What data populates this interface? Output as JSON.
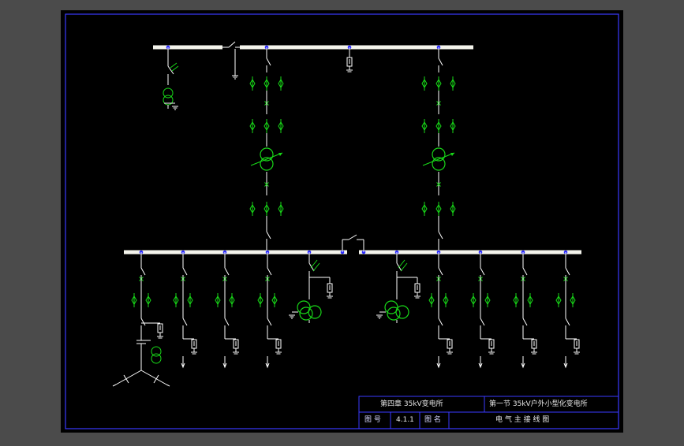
{
  "colors": {
    "background": "#4b4b4b",
    "sheet": "#000000",
    "frame": "#3a3aff",
    "busbar": "#f4f4ec",
    "equipment": "#18d818",
    "wiring": "#ffffff",
    "node": "#2a2aff"
  },
  "title_block": {
    "chapter": "第四章 35kV变电所",
    "section": "第一节 35kV户外小型化变电所",
    "drawing_no_label": "图 号",
    "drawing_no": "4.1.1",
    "drawing_name_label": "图 名",
    "drawing_name": "电 气 主 接 线 图"
  }
}
